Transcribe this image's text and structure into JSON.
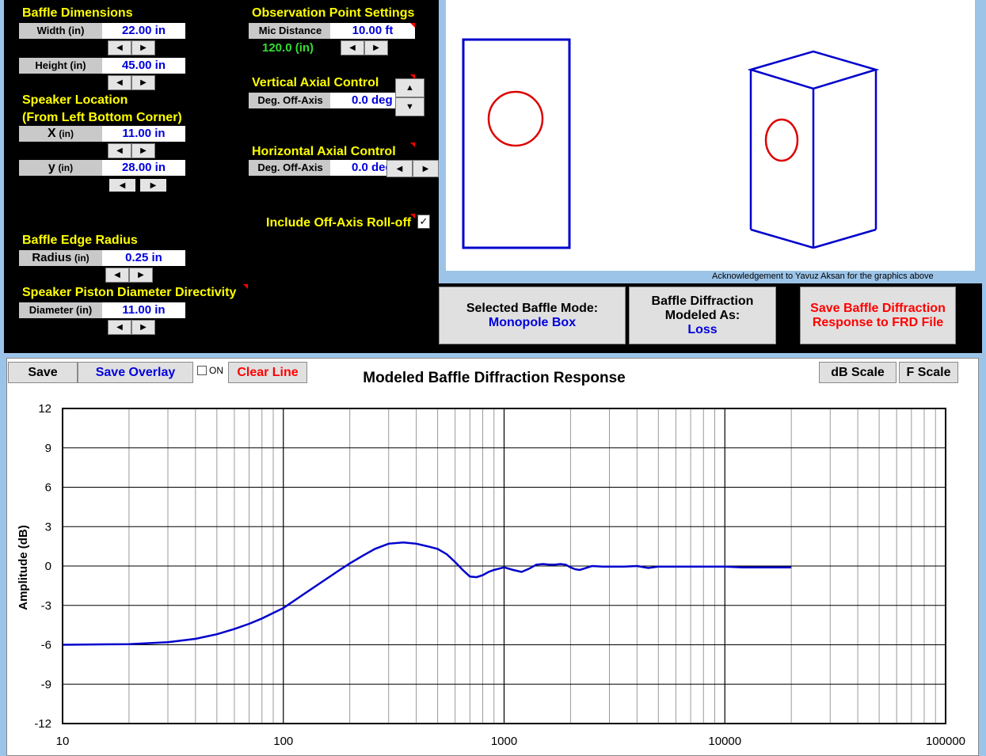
{
  "baffle_dimensions": {
    "title": "Baffle Dimensions",
    "width_label": "Width (in)",
    "width_value": "22.00 in",
    "height_label": "Height (in)",
    "height_value": "45.00 in"
  },
  "speaker_location": {
    "title": "Speaker Location",
    "subtitle": "(From Left Bottom Corner)",
    "x_label_main": "X",
    "x_label_unit": "(in)",
    "x_value": "11.00 in",
    "y_label_main": "y",
    "y_label_unit": "(in)",
    "y_value": "28.00 in"
  },
  "edge_radius": {
    "title": "Baffle Edge Radius",
    "label_main": "Radius",
    "label_unit": "(in)",
    "value": "0.25 in"
  },
  "piston": {
    "title": "Speaker Piston Diameter Directivity",
    "label": "Diameter (in)",
    "value": "11.00 in"
  },
  "observation": {
    "title": "Observation Point Settings",
    "mic_label": "Mic Distance",
    "mic_value": "10.00 ft",
    "mic_inches": "120.0 (in)"
  },
  "vertical": {
    "title": "Vertical Axial Control",
    "label": "Deg. Off-Axis",
    "value": "0.0 deg"
  },
  "horizontal": {
    "title": "Horizontal Axial Control",
    "label": "Deg. Off-Axis",
    "value": "0.0 deg"
  },
  "rolloff": {
    "label": "Include Off-Axis Roll-off",
    "checked": true,
    "mark": "✓"
  },
  "ack": "Acknowledgement to Yavuz Aksan for the graphics above",
  "mode": {
    "label": "Selected Baffle Mode:",
    "value": "Monopole Box"
  },
  "modeled": {
    "line1": "Baffle Diffraction",
    "line2": "Modeled As:",
    "value": "Loss"
  },
  "save_frd": {
    "line1": "Save Baffle Diffraction",
    "line2": "Response to FRD File"
  },
  "toolbar": {
    "save": "Save",
    "save_overlay": "Save Overlay",
    "on": "ON",
    "clear_line": "Clear Line",
    "db_scale": "dB Scale",
    "f_scale": "F Scale"
  },
  "arrows": {
    "left": "◀",
    "right": "▶",
    "up": "▲",
    "down": "▼"
  },
  "colors": {
    "accent": "#0000dd",
    "title_yellow": "#ffff00",
    "alert_red": "#ff0000",
    "curve": "#0000cc"
  },
  "chart_data": {
    "type": "line",
    "title": "Modeled Baffle Diffraction Response",
    "xlabel": "",
    "ylabel": "Amplitude (dB)",
    "xscale": "log",
    "xlim": [
      10,
      100000
    ],
    "ylim": [
      -12,
      12
    ],
    "yticks": [
      12,
      9,
      6,
      3,
      0,
      -3,
      -6,
      -9,
      -12
    ],
    "ytick_labels": [
      "12",
      "9",
      "6",
      "3",
      "0",
      "-3",
      "-6",
      "-9",
      "-12"
    ],
    "xticks": [
      10,
      100,
      1000,
      10000,
      100000
    ],
    "xtick_labels": [
      "10",
      "100",
      "1000",
      "10000",
      "100000"
    ],
    "grid": true,
    "series": [
      {
        "x": [
          10,
          20,
          30,
          40,
          50,
          60,
          70,
          80,
          100,
          120,
          150,
          180,
          200,
          230,
          260,
          300,
          350,
          400,
          450,
          500,
          550,
          600,
          650,
          700,
          750,
          800,
          850,
          900,
          950,
          1000,
          1100,
          1200,
          1300,
          1400,
          1500,
          1600,
          1700,
          1800,
          1900,
          2000,
          2100,
          2200,
          2300,
          2500,
          2800,
          3000,
          3500,
          4000,
          4500,
          5000,
          6000,
          7000,
          8000,
          10000,
          12000,
          15000,
          20000
        ],
        "y": [
          -6.0,
          -5.95,
          -5.8,
          -5.55,
          -5.2,
          -4.8,
          -4.4,
          -4.0,
          -3.2,
          -2.3,
          -1.2,
          -0.3,
          0.2,
          0.8,
          1.3,
          1.7,
          1.8,
          1.7,
          1.5,
          1.3,
          0.9,
          0.3,
          -0.3,
          -0.8,
          -0.85,
          -0.7,
          -0.45,
          -0.3,
          -0.2,
          -0.1,
          -0.3,
          -0.45,
          -0.2,
          0.1,
          0.15,
          0.1,
          0.1,
          0.15,
          0.1,
          -0.1,
          -0.25,
          -0.3,
          -0.2,
          0.0,
          -0.05,
          -0.05,
          -0.05,
          0.0,
          -0.15,
          -0.05,
          -0.05,
          -0.05,
          -0.05,
          -0.05,
          -0.1,
          -0.1,
          -0.1
        ]
      }
    ]
  }
}
